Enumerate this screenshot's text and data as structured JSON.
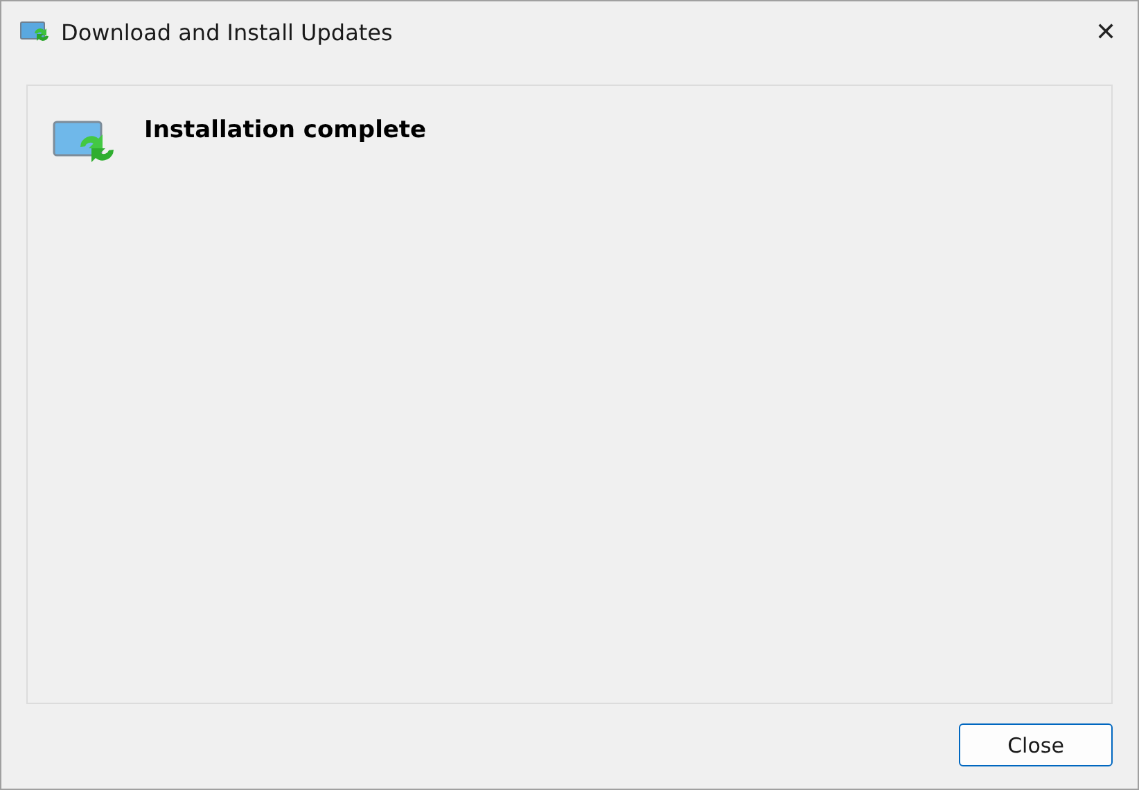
{
  "window": {
    "title": "Download and Install Updates",
    "close_glyph": "✕"
  },
  "panel": {
    "heading": "Installation complete"
  },
  "buttons": [
    {
      "label": "Close",
      "default": true
    }
  ]
}
